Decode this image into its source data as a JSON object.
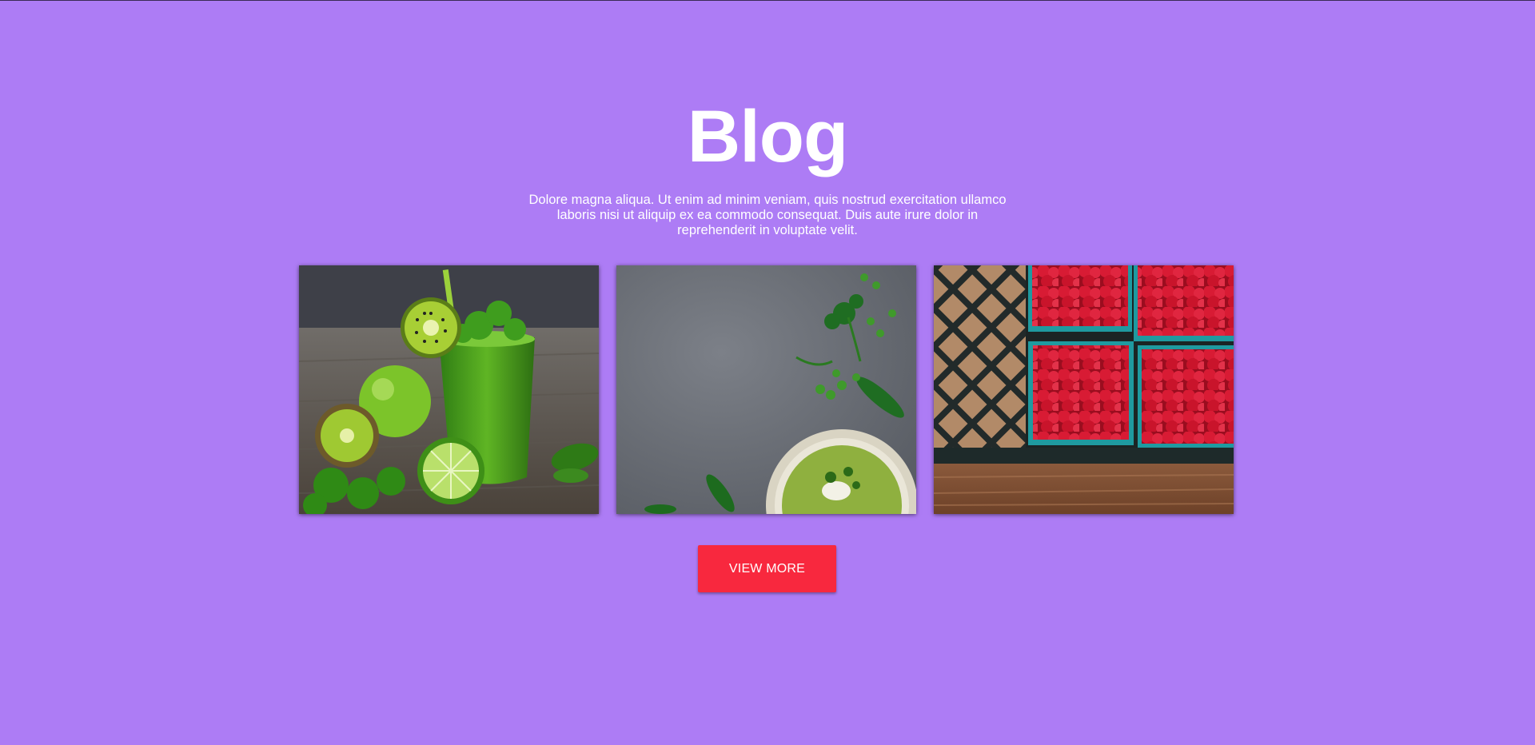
{
  "section": {
    "title": "Blog",
    "intro": "Dolore magna aliqua. Ut enim ad minim veniam, quis nostrud exercitation ullamco laboris nisi ut aliquip ex ea commodo consequat. Duis aute irure dolor in reprehenderit in voluptate velit."
  },
  "cards": [
    {
      "image": "green-smoothie-kiwi-apple-photo"
    },
    {
      "image": "pea-soup-on-slate-photo"
    },
    {
      "image": "raspberry-baskets-photo"
    }
  ],
  "button": {
    "label": "VIEW MORE"
  },
  "colors": {
    "background": "#ad7cf5",
    "button": "#f8283e",
    "text": "#ffffff"
  }
}
